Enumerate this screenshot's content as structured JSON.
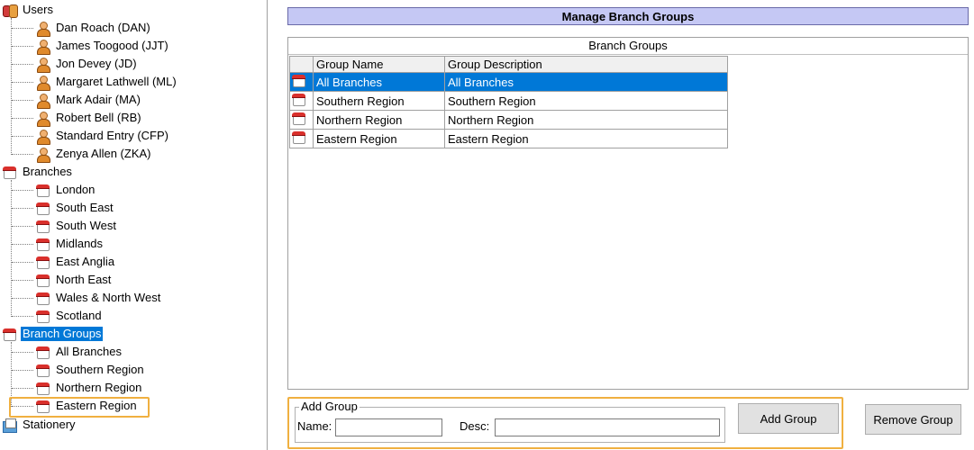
{
  "tree": {
    "users": {
      "label": "Users",
      "items": [
        "Dan Roach  (DAN)",
        "James Toogood  (JJT)",
        "Jon Devey  (JD)",
        "Margaret Lathwell  (ML)",
        "Mark Adair  (MA)",
        "Robert Bell  (RB)",
        "Standard Entry  (CFP)",
        "Zenya Allen  (ZKA)"
      ]
    },
    "branches": {
      "label": "Branches",
      "items": [
        "London",
        "South East",
        "South West",
        "Midlands",
        "East Anglia",
        "North East",
        "Wales & North West",
        "Scotland"
      ]
    },
    "branch_groups": {
      "label": "Branch Groups",
      "selected": true,
      "items": [
        "All Branches",
        "Southern Region",
        "Northern Region",
        "Eastern Region"
      ]
    },
    "stationery": {
      "label": "Stationery"
    }
  },
  "panel": {
    "title": "Manage Branch Groups",
    "grid_caption": "Branch Groups",
    "columns": [
      "Group Name",
      "Group Description"
    ],
    "rows": [
      {
        "name": "All Branches",
        "desc": "All Branches",
        "selected": true
      },
      {
        "name": "Southern Region",
        "desc": "Southern Region",
        "selected": false
      },
      {
        "name": "Northern Region",
        "desc": "Northern Region",
        "selected": false
      },
      {
        "name": "Eastern Region",
        "desc": "Eastern Region",
        "selected": false
      }
    ]
  },
  "add_group": {
    "legend": "Add Group",
    "name_label": "Name:",
    "name_value": "",
    "desc_label": "Desc:",
    "desc_value": "",
    "add_button": "Add Group"
  },
  "remove_button": "Remove Group",
  "colors": {
    "selection": "#0078d7",
    "title_bar": "#c5c8f4",
    "highlight": "#f0b040"
  }
}
